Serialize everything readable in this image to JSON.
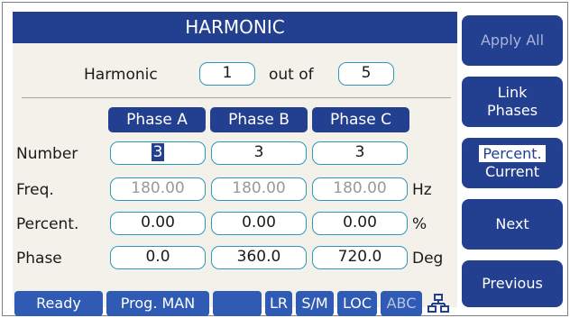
{
  "title": "HARMONIC",
  "harmonic_row": {
    "label": "Harmonic",
    "index": "1",
    "out_of_label": "out of",
    "total": "5"
  },
  "phase_headers": [
    "Phase A",
    "Phase B",
    "Phase C"
  ],
  "rows": {
    "number": {
      "label": "Number",
      "values": [
        "3",
        "3",
        "3"
      ]
    },
    "freq": {
      "label": "Freq.",
      "values": [
        "180.00",
        "180.00",
        "180.00"
      ],
      "unit": "Hz"
    },
    "percent": {
      "label": "Percent.",
      "values": [
        "0.00",
        "0.00",
        "0.00"
      ],
      "unit": "%"
    },
    "phase": {
      "label": "Phase",
      "values": [
        "0.0",
        "360.0",
        "720.0"
      ],
      "unit": "Deg"
    }
  },
  "status": {
    "ready": "Ready",
    "prog": "Prog. MAN",
    "lr": "LR",
    "sm": "S/M",
    "loc": "LOC",
    "abc": "ABC",
    "network_icon": "network-icon"
  },
  "softkeys": {
    "apply_all": "Apply All",
    "link_phases_line1": "Link",
    "link_phases_line2": "Phases",
    "percent_current_line1": "Percent.",
    "percent_current_line2": "Current",
    "next": "Next",
    "previous": "Previous"
  }
}
